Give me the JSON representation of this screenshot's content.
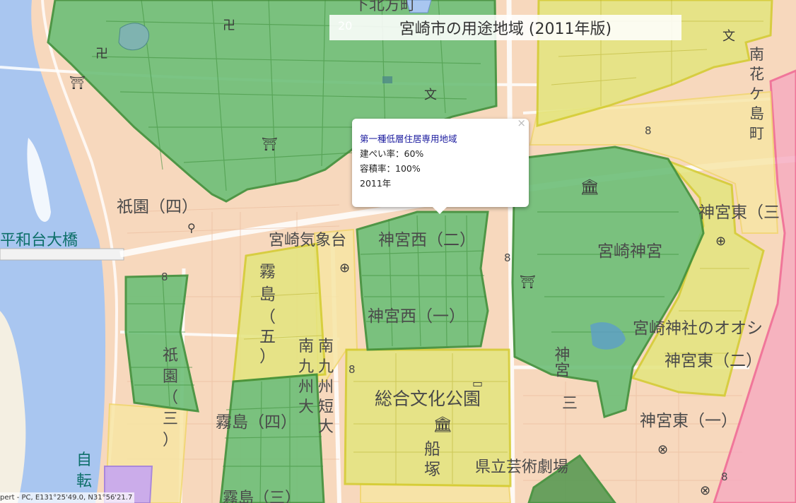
{
  "map": {
    "title": "宮崎市の用途地域 (2011年版)",
    "colors": {
      "background": "#f7d8bd",
      "river": "#a9c6f0",
      "green_zone": "#6dbf78",
      "green_border": "#3d8f3a",
      "yellow_zone": "#e4e57e",
      "yellow_border": "#d2cc2c",
      "light_yellow_zone": "#f7e6a4",
      "pink_zone": "#f6aac0",
      "pink_border": "#ef5e92",
      "purple_zone": "#c7a7f2",
      "road": "#ffffff"
    },
    "labels": {
      "gion4": "祇園（四）",
      "miyazaki_kishodai": "宮崎気象台",
      "jingu_nishi_2": "神宮西（二）",
      "jingu_nishi_1": "神宮西（一）",
      "miyazaki_jingu": "宮崎神宮",
      "jingu_nishi_branch": "神宮",
      "jingu_higashi_3": "神宮東（三",
      "jingu_higashi_2": "神宮東（二）",
      "jingu_higashi_1": "神宮東（一）",
      "oogashi": "宮崎神社のオオシ",
      "kirishima_5_a": "霧",
      "kirishima_5_b": "島",
      "kirishima_5_c": "（",
      "kirishima_5_d": "五",
      "kirishima_5_e": "）",
      "kirishima4": "霧島（四）",
      "kirishima3": "霧島（三）",
      "gion3_a": "祇",
      "gion3_b": "園",
      "gion3_c": "（",
      "gion3_d": "三",
      "gion3_e": "）",
      "minami_kyushu_a": "南",
      "minami_kyushu_b": "九",
      "minami_kyushu_c": "州",
      "minami_kyushu_d": "大",
      "minami_kyushu2_a": "南",
      "minami_kyushu2_b": "九",
      "minami_kyushu2_c": "州",
      "minami_kyushu2_d": "短",
      "minami_kyushu2_e": "大",
      "sogo_bunka_koen": "総合文化公園",
      "funazuka_a": "船",
      "funazuka_b": "塚",
      "kenritsu_geijutsu_gekijo": "県立芸術劇場",
      "heiwadai_ohashi": "平和台大橋",
      "minami_hanagashima_a": "南",
      "minami_hanagashima_b": "花",
      "minami_hanagashima_c": "ケ",
      "minami_hanagashima_d": "島",
      "minami_hanagashima_e": "町",
      "kita_kata_machi": "下北方町",
      "num8_a": "8",
      "num8_b": "8",
      "num8_c": "8",
      "num8_d": "8",
      "num8_e": "8",
      "num20": "20",
      "ji_a": "自",
      "ji_b": "転",
      "san": "三"
    }
  },
  "popup": {
    "zone_name": "第一種低層住居専用地域",
    "coverage_ratio": "建ぺい率：60%",
    "floor_area_ratio": "容積率：100%",
    "year": "2011年",
    "close_label": "×"
  },
  "status": {
    "coords": "pert - PC, E131°25'49.0, N31°56'21.7"
  }
}
